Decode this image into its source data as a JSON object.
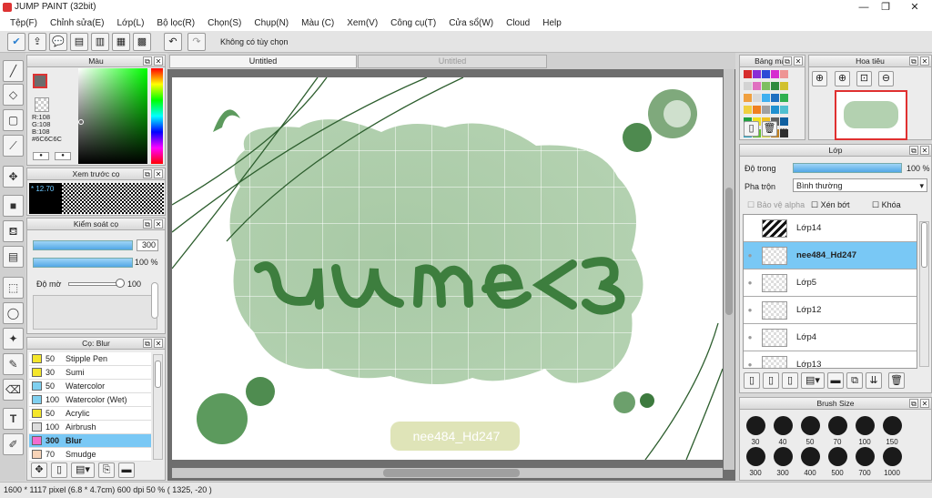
{
  "window": {
    "title": "JUMP PAINT (32bit)"
  },
  "menu": [
    "Tệp(F)",
    "Chỉnh sửa(E)",
    "Lớp(L)",
    "Bộ lọc(R)",
    "Chọn(S)",
    "Chụp(N)",
    "Màu (C)",
    "Xem(V)",
    "Công cụ(T)",
    "Cửa sổ(W)",
    "Cloud",
    "Help"
  ],
  "toolbar": {
    "selection_label": "Không có tùy chọn"
  },
  "color_panel": {
    "title": "Màu",
    "r": "R:108",
    "g": "G:108",
    "b": "B:108",
    "hex": "#6C6C6C",
    "fg_color": "#6c6c6c"
  },
  "preview_panel": {
    "title": "Xem trước cọ",
    "zoom": "12.70"
  },
  "brush_control": {
    "title": "Kiểm soát cọ",
    "size": "300",
    "opacity": "100 %",
    "density_label": "Độ mờ",
    "density": "100"
  },
  "brush_panel": {
    "title": "Cọ: Blur",
    "items": [
      {
        "size": "50",
        "name": "Stipple Pen",
        "color": "#f4e62a"
      },
      {
        "size": "30",
        "name": "Sumi",
        "color": "#f4e62a"
      },
      {
        "size": "50",
        "name": "Watercolor",
        "color": "#7fd0f0"
      },
      {
        "size": "100",
        "name": "Watercolor (Wet)",
        "color": "#7fd0f0"
      },
      {
        "size": "50",
        "name": "Acrylic",
        "color": "#f4e62a"
      },
      {
        "size": "100",
        "name": "Airbrush",
        "color": "#dddddd"
      },
      {
        "size": "300",
        "name": "Blur",
        "color": "#f46ccf"
      },
      {
        "size": "70",
        "name": "Smudge",
        "color": "#f8d4b8"
      }
    ]
  },
  "tabs": [
    "Untitled",
    "Untitled"
  ],
  "canvas": {
    "text": "nee484_Hd247"
  },
  "palette_panel": {
    "title": "Bảng màu",
    "colors": [
      "#d62d2d",
      "#8a2dd6",
      "#2d4bd6",
      "#d62dd0",
      "#ee9494",
      "#d3d3d3",
      "#e070c0",
      "#7fbf60",
      "#2f8a3f",
      "#d1c12e",
      "#f0a040",
      "#d9d9d9",
      "#40b0f0",
      "#1f70c0",
      "#30b050",
      "#f0d040",
      "#f08020",
      "#a0a0a0",
      "#2090d0",
      "#50c0d0",
      "#20a040",
      "#f0e020",
      "#f0c020",
      "#606060",
      "#1060a0",
      "#20a0c0",
      "#60c030",
      "#e0e040",
      "#c08020",
      "#303030"
    ]
  },
  "navigator_panel": {
    "title": "Hoa tiêu"
  },
  "layer_panel": {
    "title": "Lớp",
    "opacity_label": "Độ trong",
    "opacity": "100 %",
    "blend_label": "Pha trộn",
    "blend": "Bình thường",
    "protect_alpha": "Bảo vệ alpha",
    "clip": "Xén bớt",
    "lock": "Khóa",
    "layers": [
      {
        "name": "Lớp14"
      },
      {
        "name": "nee484_Hd247"
      },
      {
        "name": "Lớp5"
      },
      {
        "name": "Lớp12"
      },
      {
        "name": "Lớp4"
      },
      {
        "name": "Lớp13"
      }
    ]
  },
  "brush_size_panel": {
    "title": "Brush Size",
    "sizes_row1": [
      "30",
      "40",
      "50",
      "70",
      "100",
      "150"
    ],
    "sizes_row2": [
      "300",
      "300",
      "400",
      "500",
      "700",
      "1000"
    ]
  },
  "status": {
    "text": "1600 * 1117 pixel   (6.8 * 4.7cm)   600 dpi   50 %   ( 1325, -20 )"
  }
}
